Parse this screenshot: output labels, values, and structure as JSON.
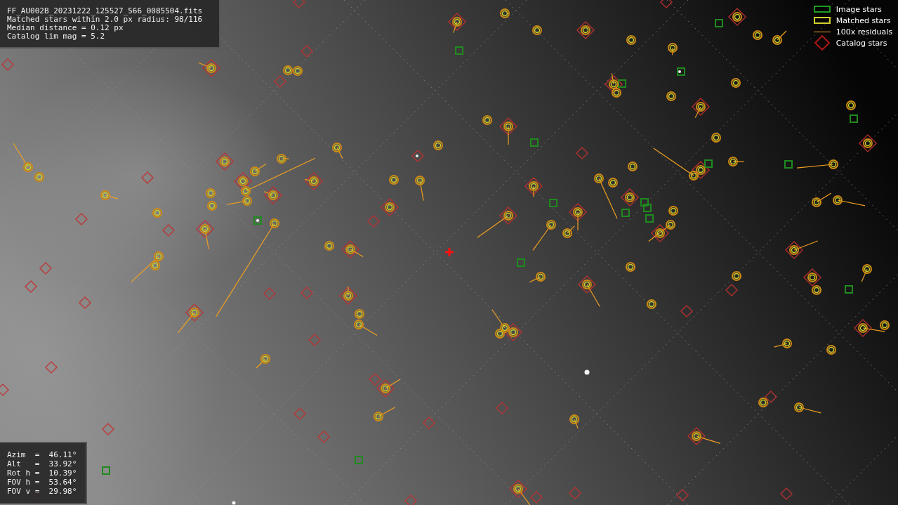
{
  "info_panel": {
    "lines": [
      "FF_AU002B_20231222_125527_566_0085504.fits",
      "Matched stars within 2.0 px radius: 98/116",
      "Median distance = 0.12 px",
      "Catalog lim mag = 5.2"
    ]
  },
  "legend": [
    {
      "label": "Image stars"
    },
    {
      "label": "Matched stars",
      "kind": "matched"
    },
    {
      "label": "100x residuals",
      "kind": "residual"
    },
    {
      "label": "Catalog stars",
      "kind": "catalog"
    }
  ],
  "pointing_panel": {
    "lines": [
      "Azim  =  46.11°",
      "Alt   =  33.92°",
      "Rot h =  10.39°",
      "FOV h =  53.64°",
      "FOV v =  29.98°"
    ]
  }
}
